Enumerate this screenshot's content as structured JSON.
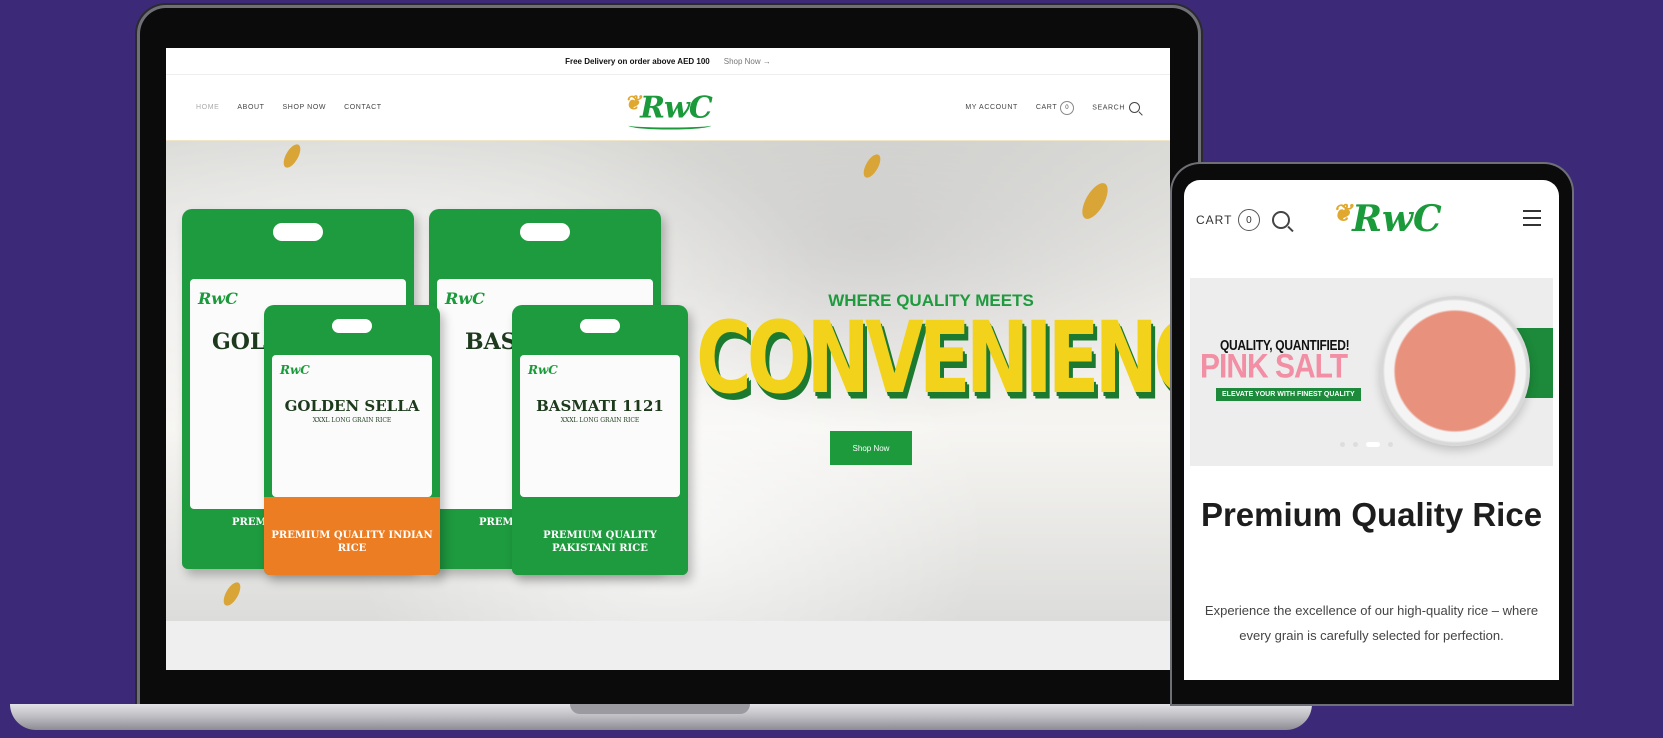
{
  "site": {
    "logo_text": "RwC",
    "announcement": {
      "message": "Free Delivery on order above AED 100",
      "link": "Shop Now →"
    },
    "nav_left": [
      "HOME",
      "ABOUT",
      "SHOP NOW",
      "CONTACT"
    ],
    "nav_right": {
      "account": "MY ACCOUNT",
      "cart": "CART",
      "cart_count": "0",
      "search": "SEARCH"
    }
  },
  "hero": {
    "heading": "WHERE QUALITY MEETS",
    "big_text": "CONVENIENCE!",
    "button": "Shop Now",
    "bags": [
      {
        "title": "GOLDEN SELLA",
        "subtitle": "XXXL LONG GRAIN RICE",
        "bottom": "PREMIUM QUALITY INDIAN RICE"
      },
      {
        "title": "BASMATI 1121",
        "subtitle": "XXXL LONG GRAIN RICE",
        "bottom": "PREMIUM QUALITY PAKISTANI RICE"
      },
      {
        "title": "GOLI",
        "bottom": "PREM PAK"
      },
      {
        "title": "BAS",
        "bottom": "PREM IN"
      }
    ]
  },
  "mobile": {
    "cart": "CART",
    "cart_count": "0",
    "banner": {
      "kicker": "QUALITY, QUANTIFIED!",
      "title": "PINK SALT",
      "tag": "ELEVATE YOUR WITH FINEST QUALITY"
    },
    "title": "Premium Quality Rice",
    "description": "Experience the excellence of our high-quality rice – where every grain is carefully selected for perfection."
  },
  "colors": {
    "background": "#3c2a78",
    "brand_green": "#1c9a3c",
    "accent_yellow": "#f3d21c",
    "pink": "#f28fa4"
  }
}
